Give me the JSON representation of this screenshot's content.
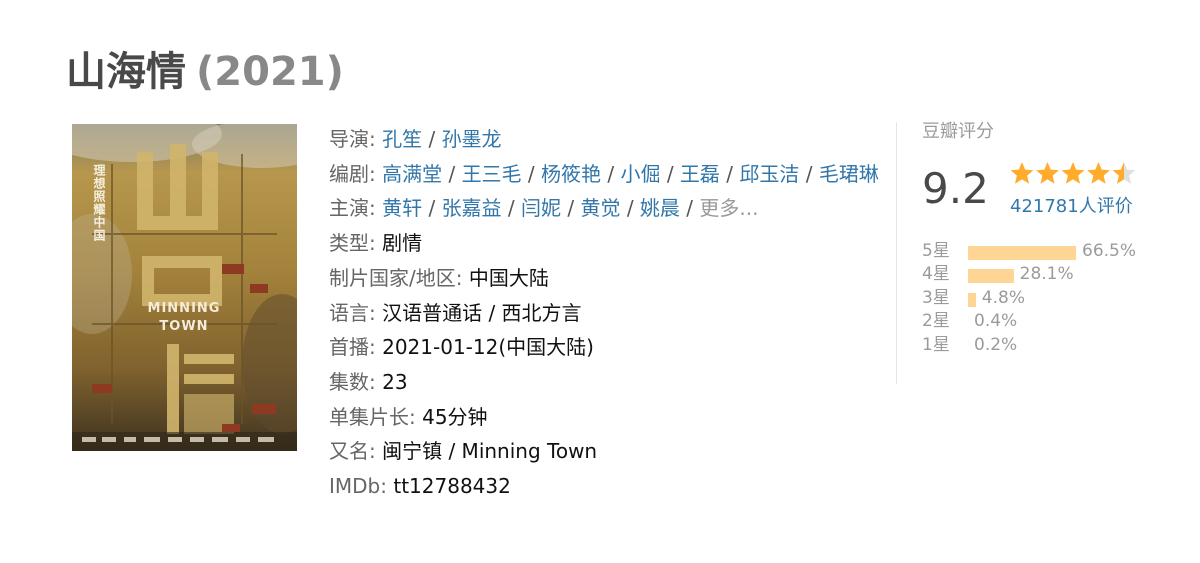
{
  "title": {
    "name": "山海情",
    "year": "(2021)"
  },
  "poster": {
    "vertical_slogan": "理想照耀中国",
    "logo_line1": "MINNING",
    "logo_line2": "TOWN",
    "colors": {
      "top": "#8c8a72",
      "mid": "#a6843c",
      "bottom": "#4b3a22"
    }
  },
  "info": {
    "director": {
      "label": "导演",
      "names": [
        "孔笙",
        "孙墨龙"
      ]
    },
    "writer": {
      "label": "编剧",
      "names": [
        "高满堂",
        "王三毛",
        "杨筱艳",
        "小倔",
        "王磊",
        "邱玉洁",
        "毛珺琳"
      ]
    },
    "cast": {
      "label": "主演",
      "names": [
        "黄轩",
        "张嘉益",
        "闫妮",
        "黄觉",
        "姚晨"
      ],
      "more": "更多..."
    },
    "genre": {
      "label": "类型",
      "value": "剧情"
    },
    "region": {
      "label": "制片国家/地区",
      "value": "中国大陆"
    },
    "language": {
      "label": "语言",
      "value": "汉语普通话 / 西北方言"
    },
    "premiere": {
      "label": "首播",
      "value": "2021-01-12(中国大陆)"
    },
    "episodes": {
      "label": "集数",
      "value": "23"
    },
    "runtime": {
      "label": "单集片长",
      "value": "45分钟"
    },
    "aka": {
      "label": "又名",
      "value": "闽宁镇 / Minning Town"
    },
    "imdb": {
      "label": "IMDb",
      "value": "tt12788432"
    },
    "link_color": "#3377aa",
    "label_color": "#666666"
  },
  "rating": {
    "heading": "豆瓣评分",
    "score": "9.2",
    "votes": "421781人评价",
    "star_value": 4.5,
    "star_color": "#ffac2d",
    "bar_color": "#ffd596",
    "distribution": [
      {
        "label": "5星",
        "pct": "66.5%",
        "value": 66.5
      },
      {
        "label": "4星",
        "pct": "28.1%",
        "value": 28.1
      },
      {
        "label": "3星",
        "pct": "4.8%",
        "value": 4.8
      },
      {
        "label": "2星",
        "pct": "0.4%",
        "value": 0.4
      },
      {
        "label": "1星",
        "pct": "0.2%",
        "value": 0.2
      }
    ]
  }
}
